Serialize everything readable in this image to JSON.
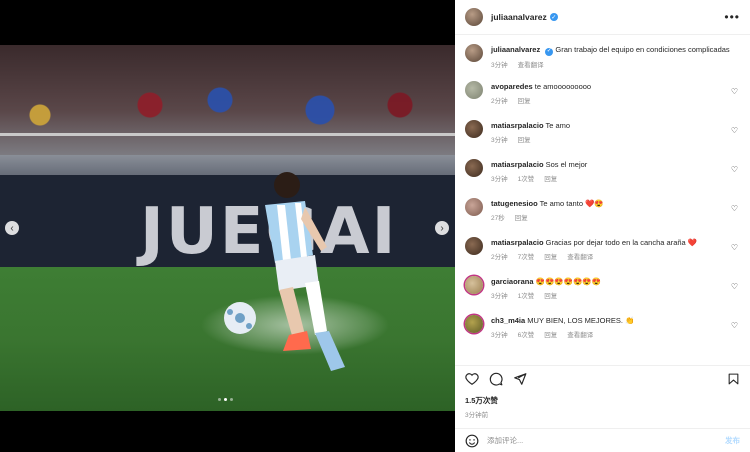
{
  "post": {
    "username": "juliaanalvarez",
    "caption": "Gran trabajo del equipo en condiciones complicadas",
    "caption_time": "3分钟",
    "caption_translate": "查看翻译",
    "photo_wall_text": "JUEGAI"
  },
  "comments": [
    {
      "user": "avoparedes",
      "text": "te amooooooooo",
      "time": "2分钟",
      "likes": "",
      "reply": "回复",
      "translate": ""
    },
    {
      "user": "matiasrpalacio",
      "text": "Te amo",
      "time": "3分钟",
      "likes": "",
      "reply": "回复",
      "translate": ""
    },
    {
      "user": "matiasrpalacio",
      "text": "Sos el mejor",
      "time": "3分钟",
      "likes": "1次赞",
      "reply": "回复",
      "translate": ""
    },
    {
      "user": "tatugenesioo",
      "text": "Te amo tanto ❤️😍",
      "time": "27秒",
      "likes": "",
      "reply": "回复",
      "translate": ""
    },
    {
      "user": "matiasrpalacio",
      "text": "Gracias por dejar todo en la cancha araña ❤️",
      "time": "2分钟",
      "likes": "7次赞",
      "reply": "回复",
      "translate": "查看翻译"
    },
    {
      "user": "garciaorana",
      "text": "😍😍😍😍😍😍😍",
      "time": "3分钟",
      "likes": "1次赞",
      "reply": "回复",
      "translate": ""
    },
    {
      "user": "ch3_m4ia",
      "text": "MUY BIEN, LOS MEJORES. 👏",
      "time": "3分钟",
      "likes": "6次赞",
      "reply": "回复",
      "translate": "查看翻译"
    }
  ],
  "actions": {
    "like_icon": "heart-icon",
    "comment_icon": "comment-icon",
    "share_icon": "share-icon",
    "save_icon": "bookmark-icon"
  },
  "stats": {
    "likes": "1.5万次赞",
    "posted": "3分钟前"
  },
  "add_comment": {
    "placeholder": "添加评论...",
    "post_label": "发布"
  },
  "colors": {
    "verified": "#3897f0",
    "muted": "#8e8e8e",
    "post_button": "#b3dbff"
  },
  "carousel": {
    "total": 3,
    "active": 2
  }
}
